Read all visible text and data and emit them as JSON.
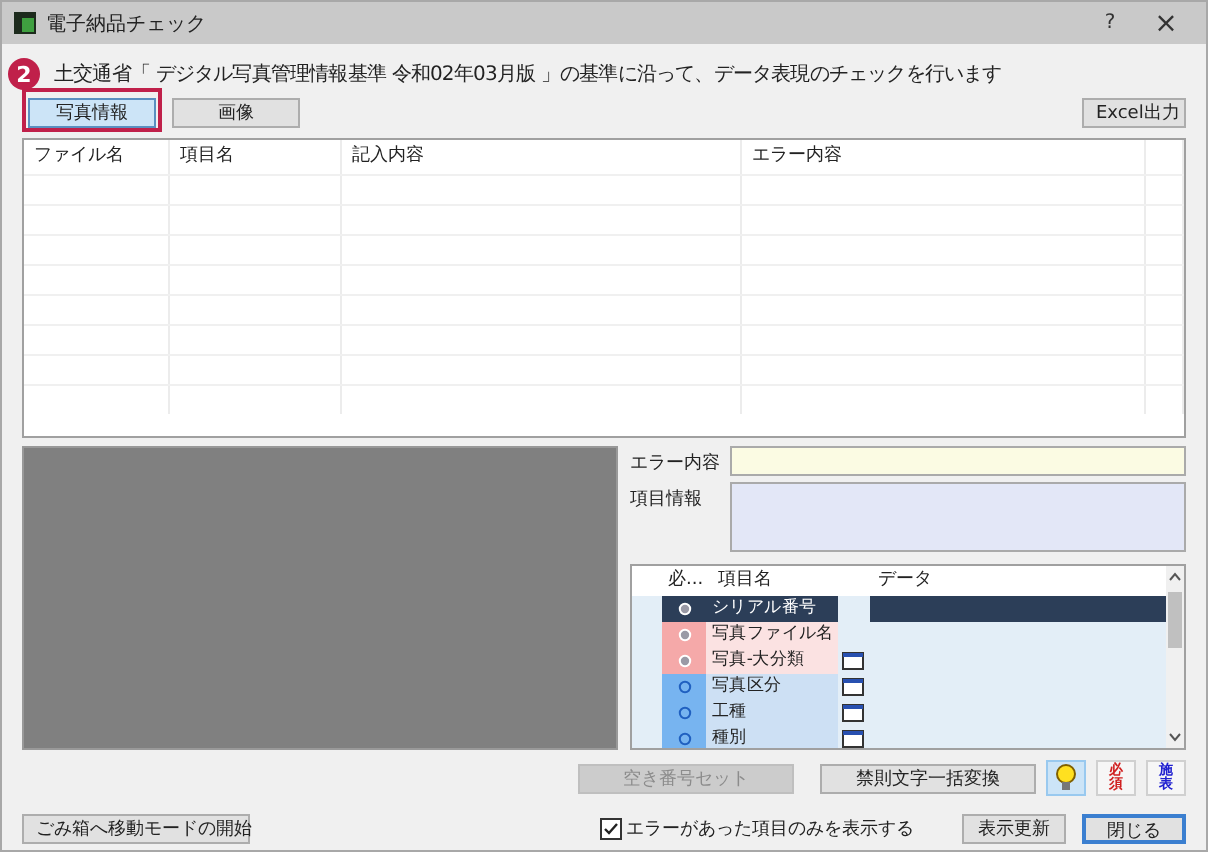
{
  "window": {
    "title": "電子納品チェック",
    "help": "?",
    "close": "×"
  },
  "description": "土交通省「 デジタル写真管理情報基準 令和02年03月版 」の基準に沿って、データ表現のチェックを行います",
  "step_badge": "2",
  "tabs": [
    {
      "label": "写真情報",
      "selected": true
    },
    {
      "label": "画像",
      "selected": false
    }
  ],
  "excel_button": "Excel出力",
  "table": {
    "columns": [
      "ファイル名",
      "項目名",
      "記入内容",
      "エラー内容"
    ]
  },
  "error_label": "エラー内容",
  "info_label": "項目情報",
  "grid": {
    "columns": [
      "必...",
      "項目名",
      "データ"
    ],
    "rows": [
      {
        "name": "シリアル番号",
        "required": true,
        "selected": true,
        "picker": false
      },
      {
        "name": "写真ファイル名",
        "required": true,
        "selected": false,
        "picker": false
      },
      {
        "name": "写真-大分類",
        "required": true,
        "selected": false,
        "picker": true
      },
      {
        "name": "写真区分",
        "required": false,
        "selected": false,
        "picker": true
      },
      {
        "name": "工種",
        "required": false,
        "selected": false,
        "picker": true
      },
      {
        "name": "種別",
        "required": false,
        "selected": false,
        "picker": true
      }
    ]
  },
  "buttons": [
    {
      "label": "空き番号セット",
      "disabled": true
    },
    {
      "label": "禁則文字一括変換",
      "disabled": false
    }
  ],
  "tool_icons": [
    {
      "kind": "bulb",
      "selected": true
    },
    {
      "kind": "text",
      "label": "必須",
      "selected": false
    },
    {
      "kind": "text",
      "label": "施表",
      "selected": false
    }
  ],
  "trash_button": "ごみ箱へ移動モードの開始",
  "errors_only": {
    "label": "エラーがあった項目のみを表示する",
    "checked": true
  },
  "refresh_button": "表示更新",
  "close_button": "閉じる"
}
